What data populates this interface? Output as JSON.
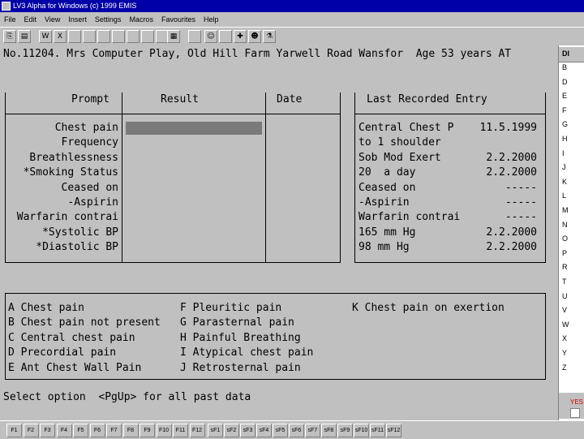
{
  "window": {
    "title": "LV3 Alpha for Windows (c) 1999 EMIS"
  },
  "menu": [
    "File",
    "Edit",
    "View",
    "Insert",
    "Settings",
    "Macros",
    "Favourites",
    "Help"
  ],
  "toolbar": {
    "buttons": [
      {
        "icon": "clipboard-icon",
        "glyph": "⎘"
      },
      {
        "icon": "save-icon",
        "glyph": "▤"
      },
      {
        "icon": "word-icon",
        "glyph": "W"
      },
      {
        "icon": "excel-icon",
        "glyph": "X"
      },
      {
        "icon": "blank-icon",
        "glyph": ""
      },
      {
        "icon": "blank-icon",
        "glyph": ""
      },
      {
        "icon": "blank-icon",
        "glyph": ""
      },
      {
        "icon": "blank-icon",
        "glyph": ""
      },
      {
        "icon": "blank-icon",
        "glyph": ""
      },
      {
        "icon": "blank-icon",
        "glyph": ""
      },
      {
        "icon": "blank-icon",
        "glyph": ""
      },
      {
        "icon": "document-icon",
        "glyph": "▦"
      },
      {
        "icon": "blank-icon",
        "glyph": ""
      },
      {
        "icon": "person-icon",
        "glyph": "☺"
      },
      {
        "icon": "blank-icon",
        "glyph": ""
      },
      {
        "icon": "plus-icon",
        "glyph": "✚"
      },
      {
        "icon": "people-icon",
        "glyph": "☻"
      },
      {
        "icon": "flask-icon",
        "glyph": "⚗"
      }
    ]
  },
  "patient": {
    "line": "No.11204. Mrs Computer Play, Old Hill Farm Yarwell Road Wansfor  Age 53 years AT"
  },
  "table": {
    "headers": {
      "prompt": "Prompt",
      "result": "Result",
      "date": "Date",
      "last": "Last Recorded Entry"
    },
    "rows": [
      {
        "prompt": "Chest pain",
        "last_text": "Central Chest P",
        "last_date": "11.5.1999"
      },
      {
        "prompt": "Frequency",
        "last_text": "to 1 shoulder",
        "last_date": ""
      },
      {
        "prompt": "Breathlessness",
        "last_text": "Sob Mod Exert",
        "last_date": "2.2.2000"
      },
      {
        "prompt": "*Smoking Status",
        "last_text": "20  a day",
        "last_date": "2.2.2000"
      },
      {
        "prompt": "Ceased on",
        "last_text": "Ceased on",
        "last_date": "-----"
      },
      {
        "prompt": "-Aspirin",
        "last_text": "-Aspirin",
        "last_date": "-----"
      },
      {
        "prompt": "Warfarin contrai",
        "last_text": "Warfarin contrai",
        "last_date": "-----"
      },
      {
        "prompt": "*Systolic BP",
        "last_text": "165 mm Hg",
        "last_date": "2.2.2000"
      },
      {
        "prompt": "*Diastolic BP",
        "last_text": "98 mm Hg",
        "last_date": "2.2.2000"
      }
    ]
  },
  "options": {
    "col1": [
      "A Chest pain",
      "B Chest pain not present",
      "C Central chest pain",
      "D Precordial pain",
      "E Ant Chest Wall Pain"
    ],
    "col2": [
      "F Pleuritic pain",
      "G Parasternal pain",
      "H Painful Breathing",
      "I Atypical chest pain",
      "J Retrosternal pain"
    ],
    "col3": [
      "K Chest pain on exertion"
    ]
  },
  "prompt_line": "Select option  <PgUp> for all past data",
  "right_panel": {
    "header": "DI",
    "letters": [
      "B",
      "D",
      "E",
      "F",
      "G",
      "H",
      "I",
      "J",
      "K",
      "L",
      "M",
      "N",
      "O",
      "P",
      "R",
      "T",
      "U",
      "V",
      "W",
      "X",
      "Y",
      "Z"
    ],
    "status": "YES"
  },
  "fkeys": [
    "F1",
    "F2",
    "F3",
    "F4",
    "F5",
    "F6",
    "F7",
    "F8",
    "F9",
    "F10",
    "F11",
    "F12",
    "sF1",
    "sF2",
    "sF3",
    "sF4",
    "sF5",
    "sF6",
    "sF7",
    "sF8",
    "sF9",
    "sF10",
    "sF11",
    "sF12"
  ]
}
